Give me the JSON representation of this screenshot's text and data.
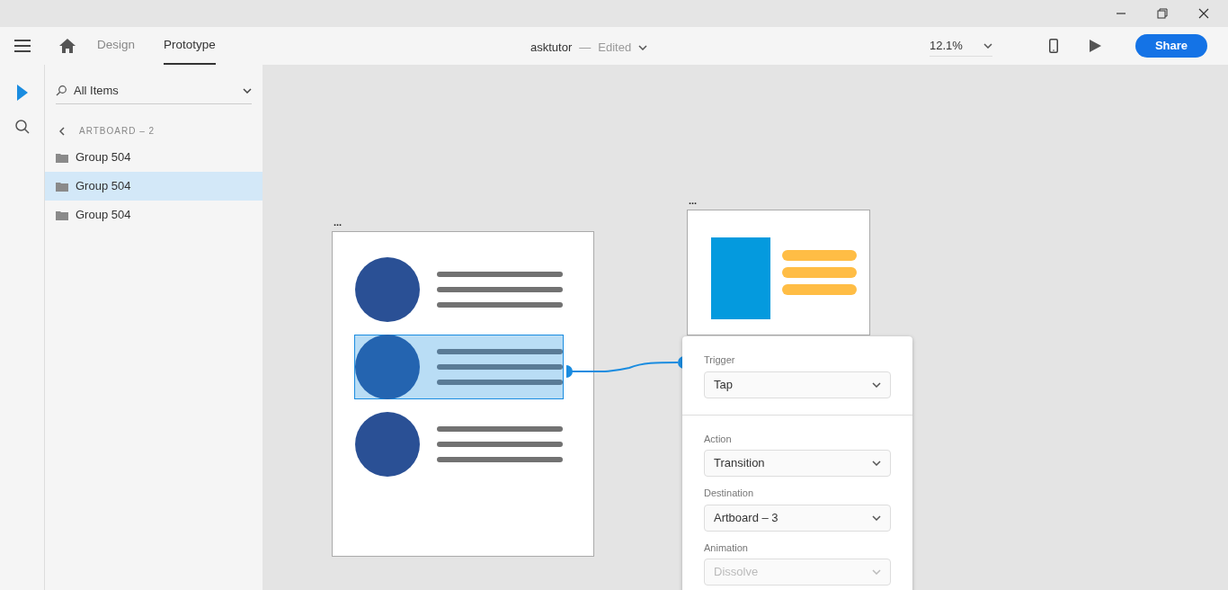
{
  "toolbar": {
    "tabs": [
      {
        "label": "Design",
        "selected": false
      },
      {
        "label": "Prototype",
        "selected": true
      }
    ],
    "document": {
      "name": "asktutor",
      "separator": "—",
      "status": "Edited"
    },
    "zoom": "12.1%",
    "share": "Share"
  },
  "rail": {
    "tools": [
      {
        "kind": "select",
        "selected": true
      },
      {
        "kind": "search",
        "selected": false
      }
    ]
  },
  "layers": {
    "filter": "All Items",
    "breadcrumb": "ARTBOARD – 2",
    "items": [
      {
        "name": "Group 504",
        "selected": false
      },
      {
        "name": "Group 504",
        "selected": true
      },
      {
        "name": "Group 504",
        "selected": false
      }
    ]
  },
  "canvas": {
    "artboards": [
      {
        "label": "...",
        "rows": [
          {
            "selected": false
          },
          {
            "selected": true
          },
          {
            "selected": false
          }
        ]
      },
      {
        "label": "..."
      }
    ],
    "interaction": {
      "sections": [
        {
          "fields": [
            {
              "label": "Trigger",
              "value": "Tap",
              "disabled": false
            }
          ]
        },
        {
          "fields": [
            {
              "label": "Action",
              "value": "Transition",
              "disabled": false
            },
            {
              "label": "Destination",
              "value": "Artboard – 3",
              "disabled": false
            },
            {
              "label": "Animation",
              "value": "Dissolve",
              "disabled": true
            }
          ]
        }
      ]
    }
  }
}
